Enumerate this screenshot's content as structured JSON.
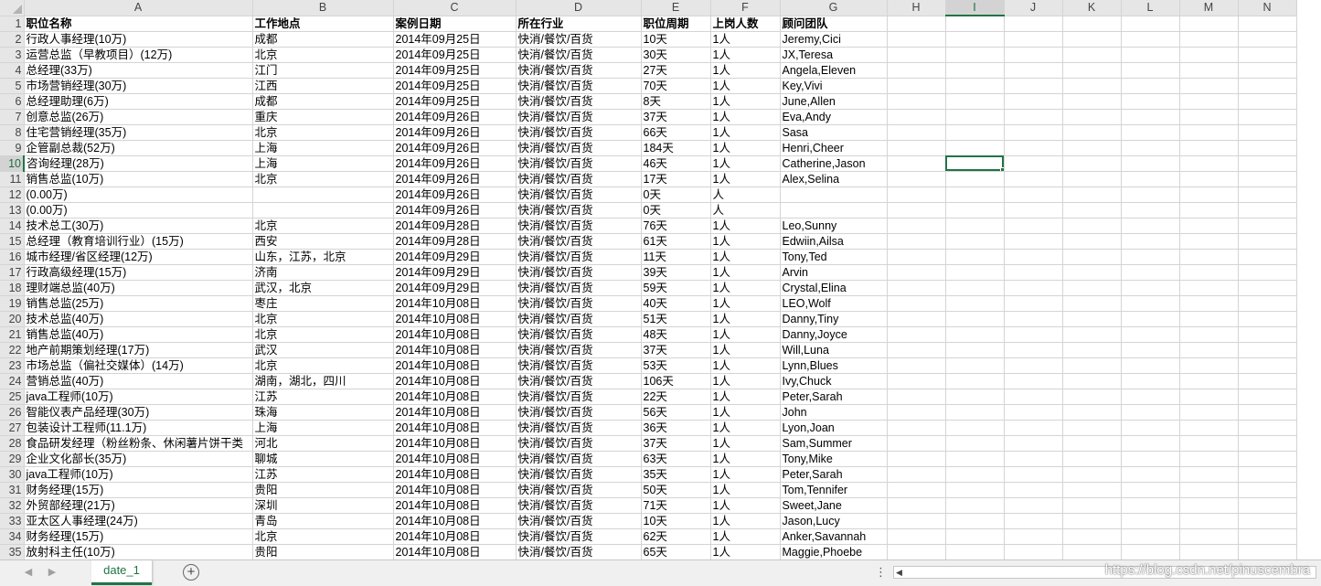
{
  "columns": [
    "A",
    "B",
    "C",
    "D",
    "E",
    "F",
    "G",
    "H",
    "I",
    "J",
    "K",
    "L",
    "M",
    "N"
  ],
  "active_column": "I",
  "active_row": 10,
  "rows": [
    [
      "职位名称",
      "工作地点",
      "案例日期",
      "所在行业",
      "职位周期",
      "上岗人数",
      "顾问团队"
    ],
    [
      "行政人事经理(10万)",
      "成都",
      "2014年09月25日",
      "快消/餐饮/百货",
      "10天",
      "1人",
      "Jeremy,Cici"
    ],
    [
      "运营总监（早教项目）(12万)",
      "北京",
      "2014年09月25日",
      "快消/餐饮/百货",
      "30天",
      "1人",
      "JX,Teresa"
    ],
    [
      "总经理(33万)",
      "江门",
      "2014年09月25日",
      "快消/餐饮/百货",
      "27天",
      "1人",
      "Angela,Eleven"
    ],
    [
      "市场营销经理(30万)",
      "江西",
      "2014年09月25日",
      "快消/餐饮/百货",
      "70天",
      "1人",
      "Key,Vivi"
    ],
    [
      "总经理助理(6万)",
      "成都",
      "2014年09月25日",
      "快消/餐饮/百货",
      "8天",
      "1人",
      "June,Allen"
    ],
    [
      "创意总监(26万)",
      "重庆",
      "2014年09月26日",
      "快消/餐饮/百货",
      "37天",
      "1人",
      "Eva,Andy"
    ],
    [
      "住宅营销经理(35万)",
      "北京",
      "2014年09月26日",
      "快消/餐饮/百货",
      "66天",
      "1人",
      "Sasa"
    ],
    [
      "企管副总裁(52万)",
      "上海",
      "2014年09月26日",
      "快消/餐饮/百货",
      "184天",
      "1人",
      "Henri,Cheer"
    ],
    [
      "咨询经理(28万)",
      "上海",
      "2014年09月26日",
      "快消/餐饮/百货",
      "46天",
      "1人",
      "Catherine,Jason"
    ],
    [
      "销售总监(10万)",
      "北京",
      "2014年09月26日",
      "快消/餐饮/百货",
      "17天",
      "1人",
      "Alex,Selina"
    ],
    [
      "(0.00万)",
      "",
      "2014年09月26日",
      "快消/餐饮/百货",
      "0天",
      "人",
      ""
    ],
    [
      "(0.00万)",
      "",
      "2014年09月26日",
      "快消/餐饮/百货",
      "0天",
      "人",
      ""
    ],
    [
      "技术总工(30万)",
      "北京",
      "2014年09月28日",
      "快消/餐饮/百货",
      "76天",
      "1人",
      "Leo,Sunny"
    ],
    [
      "总经理（教育培训行业）(15万)",
      "西安",
      "2014年09月28日",
      "快消/餐饮/百货",
      "61天",
      "1人",
      "Edwiin,Ailsa"
    ],
    [
      "城市经理/省区经理(12万)",
      "山东，江苏，北京",
      "2014年09月29日",
      "快消/餐饮/百货",
      "11天",
      "1人",
      "Tony,Ted"
    ],
    [
      "行政高级经理(15万)",
      "济南",
      "2014年09月29日",
      "快消/餐饮/百货",
      "39天",
      "1人",
      "Arvin"
    ],
    [
      "理财端总监(40万)",
      "武汉，北京",
      "2014年09月29日",
      "快消/餐饮/百货",
      "59天",
      "1人",
      "Crystal,Elina"
    ],
    [
      "销售总监(25万)",
      "枣庄",
      "2014年10月08日",
      "快消/餐饮/百货",
      "40天",
      "1人",
      "LEO,Wolf"
    ],
    [
      "技术总监(40万)",
      "北京",
      "2014年10月08日",
      "快消/餐饮/百货",
      "51天",
      "1人",
      "Danny,Tiny"
    ],
    [
      "销售总监(40万)",
      "北京",
      "2014年10月08日",
      "快消/餐饮/百货",
      "48天",
      "1人",
      "Danny,Joyce"
    ],
    [
      "地产前期策划经理(17万)",
      "武汉",
      "2014年10月08日",
      "快消/餐饮/百货",
      "37天",
      "1人",
      "Will,Luna"
    ],
    [
      "市场总监（偏社交媒体）(14万)",
      "北京",
      "2014年10月08日",
      "快消/餐饮/百货",
      "53天",
      "1人",
      "Lynn,Blues"
    ],
    [
      "营销总监(40万)",
      "湖南，湖北，四川",
      "2014年10月08日",
      "快消/餐饮/百货",
      "106天",
      "1人",
      "Ivy,Chuck"
    ],
    [
      "java工程师(10万)",
      "江苏",
      "2014年10月08日",
      "快消/餐饮/百货",
      "22天",
      "1人",
      "Peter,Sarah"
    ],
    [
      "智能仪表产品经理(30万)",
      "珠海",
      "2014年10月08日",
      "快消/餐饮/百货",
      "56天",
      "1人",
      "John"
    ],
    [
      "包装设计工程师(11.1万)",
      "上海",
      "2014年10月08日",
      "快消/餐饮/百货",
      "36天",
      "1人",
      "Lyon,Joan"
    ],
    [
      "食品研发经理（粉丝粉条、休闲薯片饼干类",
      "河北",
      "2014年10月08日",
      "快消/餐饮/百货",
      "37天",
      "1人",
      "Sam,Summer"
    ],
    [
      "企业文化部长(35万)",
      "聊城",
      "2014年10月08日",
      "快消/餐饮/百货",
      "63天",
      "1人",
      "Tony,Mike"
    ],
    [
      "java工程师(10万)",
      "江苏",
      "2014年10月08日",
      "快消/餐饮/百货",
      "35天",
      "1人",
      "Peter,Sarah"
    ],
    [
      "财务经理(15万)",
      "贵阳",
      "2014年10月08日",
      "快消/餐饮/百货",
      "50天",
      "1人",
      "Tom,Tennifer"
    ],
    [
      "外贸部经理(21万)",
      "深圳",
      "2014年10月08日",
      "快消/餐饮/百货",
      "71天",
      "1人",
      "Sweet,Jane"
    ],
    [
      "亚太区人事经理(24万)",
      "青岛",
      "2014年10月08日",
      "快消/餐饮/百货",
      "10天",
      "1人",
      "Jason,Lucy"
    ],
    [
      "财务经理(15万)",
      "北京",
      "2014年10月08日",
      "快消/餐饮/百货",
      "62天",
      "1人",
      "Anker,Savannah"
    ],
    [
      "放射科主任(10万)",
      "贵阳",
      "2014年10月08日",
      "快消/餐饮/百货",
      "65天",
      "1人",
      "Maggie,Phoebe"
    ]
  ],
  "sheet_tab": "date_1",
  "add_sheet_glyph": "+",
  "more_glyph": "⋮",
  "scroll_left_glyph": "◀",
  "nav_prev_glyph": "◀",
  "nav_next_glyph": "▶",
  "watermark": "https://blog.csdn.net/pinuscembra"
}
